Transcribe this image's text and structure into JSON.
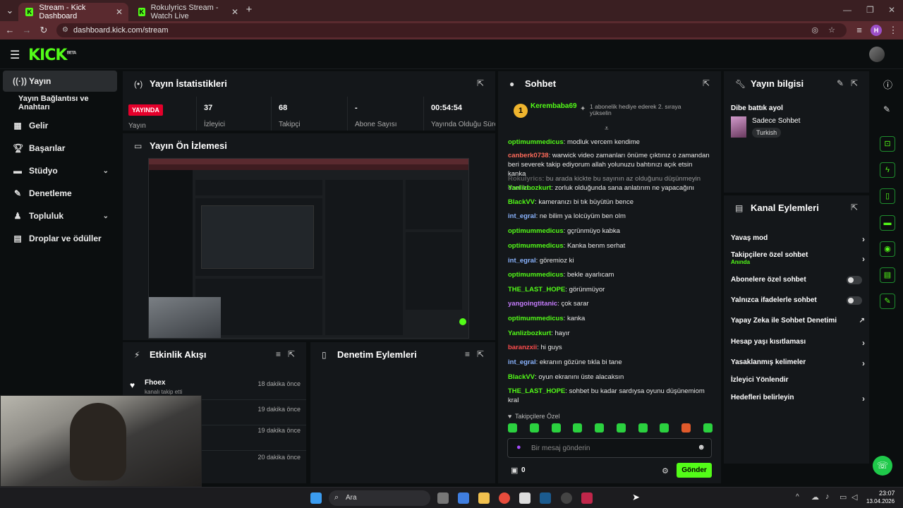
{
  "browser": {
    "tabs": [
      {
        "title": "Stream - Kick Dashboard"
      },
      {
        "title": "Rokulyrics Stream - Watch Live"
      }
    ],
    "url": "dashboard.kick.com/stream",
    "profile_initial": "H"
  },
  "header": {
    "logo": "KICK",
    "logo_badge": "BETA"
  },
  "sidebar": {
    "items": [
      {
        "label": "Yayın"
      },
      {
        "label": "Yayın Bağlantısı ve Anahtarı"
      },
      {
        "label": "Gelir"
      },
      {
        "label": "Başarılar"
      },
      {
        "label": "Stüdyo"
      },
      {
        "label": "Denetleme"
      },
      {
        "label": "Topluluk"
      },
      {
        "label": "Droplar ve ödüller"
      }
    ]
  },
  "stats": {
    "title": "Yayın İstatistikleri",
    "live_badge": "YAYINDA",
    "live_label": "Yayın",
    "viewers": {
      "value": "37",
      "label": "İzleyici"
    },
    "followers": {
      "value": "68",
      "label": "Takipçi"
    },
    "subs": {
      "value": "-",
      "label": "Abone Sayısı"
    },
    "uptime": {
      "value": "00:54:54",
      "label": "Yayında Olduğu Süre"
    }
  },
  "preview": {
    "title": "Yayın Ön İzlemesi"
  },
  "activity": {
    "title": "Etkinlik Akışı",
    "items": [
      {
        "name": "Fhoex",
        "desc": "kanalı takip etti",
        "time": "18 dakika önce"
      },
      {
        "name": "",
        "desc": "",
        "time": "19 dakika önce"
      },
      {
        "name": "",
        "desc": "",
        "time": "19 dakika önce"
      },
      {
        "name": "",
        "desc": "",
        "time": "20 dakika önce"
      }
    ]
  },
  "mod_actions": {
    "title": "Denetim Eylemleri"
  },
  "chat": {
    "title": "Sohbet",
    "pinned_user": "Kerembaba69",
    "pinned_rank": "1",
    "pinned_text": "1 abonelik hediye ederek 2. sıraya yükselin",
    "messages": [
      {
        "user": "optimummedicus",
        "color": "#53fc18",
        "text": "modluk vercem kendime"
      },
      {
        "user": "canberk0738",
        "color": "#ff6b5a",
        "text": "warwick video zamanları önüme çıktınız o zamandan beri severek takip ediyorum allah yolunuzu bahtınızı açık etsin kanka"
      },
      {
        "user": "Rokulyrics",
        "color": "#888888",
        "text": "bu arada kickte bu sayının az olduğunu düşünmeyin özelliki..."
      },
      {
        "user": "Yanlizbozkurt",
        "color": "#53fc18",
        "text": "zorluk olduğunda sana anlatırım ne yapacağını"
      },
      {
        "user": "BlackVV",
        "color": "#53fc18",
        "text": "kameranızı bi tık büyütün bence"
      },
      {
        "user": "int_egral",
        "color": "#8ab4ff",
        "text": "ne bilim ya lolcüyüm ben olm"
      },
      {
        "user": "optimummedicus",
        "color": "#53fc18",
        "text": "gçrünmüyo kabka"
      },
      {
        "user": "optimummedicus",
        "color": "#53fc18",
        "text": "Kanka benm serhat"
      },
      {
        "user": "int_egral",
        "color": "#8ab4ff",
        "text": "göremioz ki"
      },
      {
        "user": "optimummedicus",
        "color": "#53fc18",
        "text": "bekle ayarlıcam"
      },
      {
        "user": "THE_LAST_HOPE",
        "color": "#53fc18",
        "text": "görünmüyor"
      },
      {
        "user": "yangoingtitanic",
        "color": "#c77dff",
        "text": "çok sarar"
      },
      {
        "user": "optimummedicus",
        "color": "#53fc18",
        "text": "kanka"
      },
      {
        "user": "Yanlizbozkurt",
        "color": "#53fc18",
        "text": "hayır"
      },
      {
        "user": "baranzxii",
        "color": "#ff4d4d",
        "text": "hi guys"
      },
      {
        "user": "int_egral",
        "color": "#8ab4ff",
        "text": "ekranın gözüne tıkla bi tane"
      },
      {
        "user": "BlackVV",
        "color": "#53fc18",
        "text": "oyun ekranını üste alacaksın"
      },
      {
        "user": "THE_LAST_HOPE",
        "color": "#53fc18",
        "text": "sohbet bu kadar sardıysa oyunu düşünemiom kral"
      }
    ],
    "follower_only_label": "Takipçilere Özel",
    "input_placeholder": "Bir mesaj gönderin",
    "points": "0",
    "send_label": "Gönder"
  },
  "stream_info": {
    "title": "Yayın bilgisi",
    "stream_title": "Dibe battık ayol",
    "category": "Sadece Sohbet",
    "tag": "Turkish"
  },
  "channel_actions": {
    "title": "Kanal Eylemleri",
    "items": [
      {
        "label": "Yavaş mod"
      },
      {
        "label": "Takipçilere özel sohbet",
        "sub": "Anında"
      },
      {
        "label": "Abonelere özel sohbet"
      },
      {
        "label": "Yalnızca ifadelerle sohbet"
      },
      {
        "label": "Yapay Zeka ile Sohbet Denetimi"
      },
      {
        "label": "Hesap yaşı kısıtlaması"
      },
      {
        "label": "Yasaklanmış kelimeler"
      },
      {
        "label": "İzleyici Yönlendir"
      },
      {
        "label": "Hedefleri belirleyin"
      }
    ]
  },
  "taskbar": {
    "search_label": "Ara",
    "time": "23:07",
    "date": "13.04.2026"
  },
  "colors": {
    "kick_green": "#53fc18",
    "live_red": "#e5002b",
    "panel_bg": "#14171a",
    "page_bg": "#0b0e0f"
  }
}
